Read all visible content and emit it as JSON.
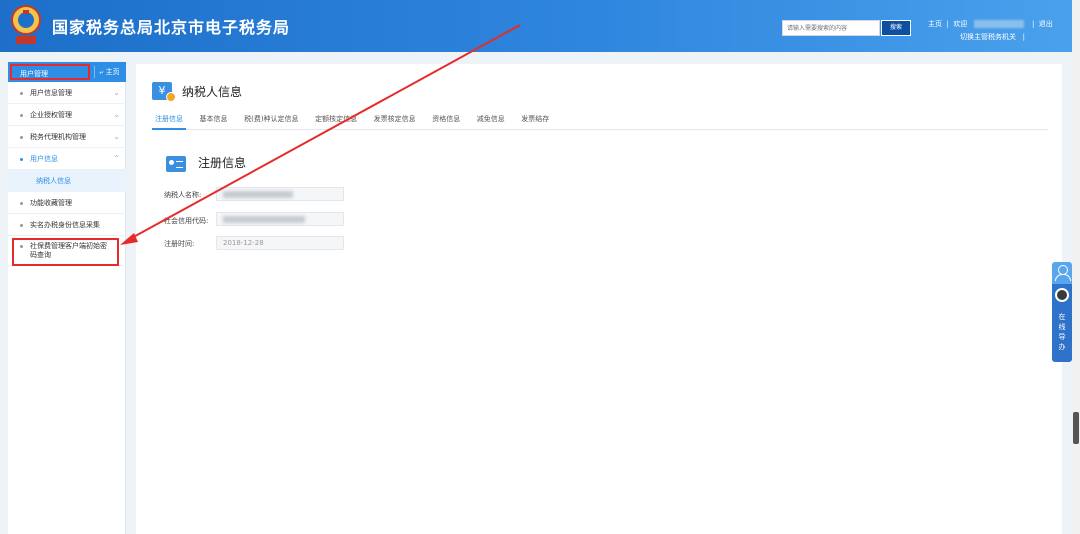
{
  "header": {
    "site_title": "国家税务总局北京市电子税务局",
    "search_placeholder": "请输入需要搜索的内容",
    "search_button": "搜索",
    "home_link": "主页",
    "welcome": "欢迎",
    "logout": "退出",
    "switch_org": "切换主管税务机关",
    "brand_color": "#2f86de"
  },
  "sidebar": {
    "title": "用户管理",
    "home_button": "主页",
    "items": [
      {
        "label": "用户信息管理",
        "expanded": false
      },
      {
        "label": "企业授权管理",
        "expanded": false
      },
      {
        "label": "税务代理机构管理",
        "expanded": false
      },
      {
        "label": "用户信息",
        "expanded": true
      },
      {
        "label": "纳税人信息"
      },
      {
        "label": "功能收藏管理"
      },
      {
        "label": "实名办税身份信息采集"
      },
      {
        "label": "社保费管理客户端初始密码查询"
      }
    ]
  },
  "main": {
    "title": "纳税人信息",
    "tabs": [
      "注册信息",
      "基本信息",
      "税(费)种认定信息",
      "定额核定信息",
      "发票核定信息",
      "资格信息",
      "减免信息",
      "发票结存"
    ],
    "active_tab": "注册信息",
    "section_title": "注册信息",
    "fields": [
      {
        "label": "纳税人名称:",
        "value": ""
      },
      {
        "label": "社会信用代码:",
        "value": ""
      },
      {
        "label": "注册时间:",
        "value": "2018-12-28"
      }
    ]
  },
  "float_widget": {
    "text": "在线导办"
  },
  "annotation_color": "#e52b2b"
}
